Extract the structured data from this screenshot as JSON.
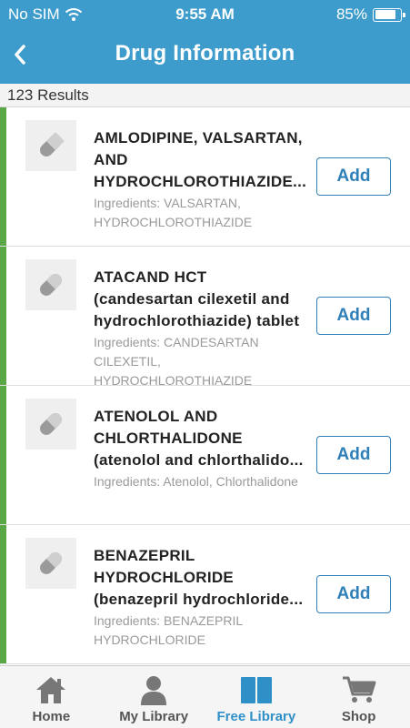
{
  "status_bar": {
    "carrier": "No SIM",
    "time": "9:55 AM",
    "battery_percent": "85%",
    "battery_level": 0.85
  },
  "header": {
    "title": "Drug Information",
    "back_icon": "chevron-left-icon"
  },
  "results": {
    "count_text": "123 Results"
  },
  "drugs": [
    {
      "title": "AMLODIPINE, VALSARTAN, AND HYDROCHLOROTHIAZIDE...",
      "ingredients": "Ingredients: VALSARTAN, HYDROCHLOROTHIAZIDE",
      "add_label": "Add",
      "icon": "pill-icon"
    },
    {
      "title": "ATACAND HCT (candesartan cilexetil and hydrochlorothiazide) tablet",
      "ingredients": "Ingredients: CANDESARTAN CILEXETIL, HYDROCHLOROTHIAZIDE",
      "add_label": "Add",
      "icon": "pill-icon"
    },
    {
      "title": "ATENOLOL AND CHLORTHALIDONE (atenolol and chlorthalido...",
      "ingredients": "Ingredients: Atenolol, Chlorthalidone",
      "add_label": "Add",
      "icon": "pill-icon"
    },
    {
      "title": "BENAZEPRIL HYDROCHLORIDE (benazepril hydrochloride...",
      "ingredients": "Ingredients: BENAZEPRIL HYDROCHLORIDE",
      "add_label": "Add",
      "icon": "pill-icon"
    }
  ],
  "tab_bar": {
    "tabs": [
      {
        "label": "Home",
        "icon": "home-icon",
        "active": false
      },
      {
        "label": "My Library",
        "icon": "person-icon",
        "active": false
      },
      {
        "label": "Free Library",
        "icon": "book-icon",
        "active": true
      },
      {
        "label": "Shop",
        "icon": "cart-icon",
        "active": false
      }
    ]
  },
  "colors": {
    "header_bg": "#3e9ccc",
    "accent_green": "#5aa845",
    "button_blue": "#2f7fb8",
    "active_tab": "#2f8fc7"
  }
}
